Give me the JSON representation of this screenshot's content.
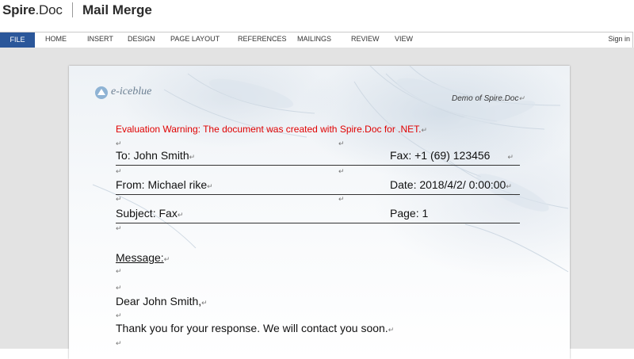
{
  "header": {
    "brand_main": "Spire",
    "brand_sub": ".Doc",
    "title": "Mail Merge"
  },
  "ribbon": {
    "file": "FILE",
    "tabs": [
      "HOME",
      "INSERT",
      "DESIGN",
      "PAGE LAYOUT",
      "REFERENCES",
      "MAILINGS",
      "REVIEW",
      "VIEW"
    ],
    "sign_in": "Sign in"
  },
  "document": {
    "logo_text": "e-iceblue",
    "demo_label": "Demo of Spire.Doc",
    "warning": "Evaluation Warning: The document was created with Spire.Doc for .NET.",
    "para_mark": "↵",
    "fields": {
      "to": "To:   John Smith",
      "fax": "Fax:  +1 (69) 123456",
      "from": "From:       Michael rike",
      "date": "Date:  2018/4/2/ 0:00:00",
      "subject": "Subject: Fax",
      "page": "Page: 1"
    },
    "message_label": "Message:",
    "greeting": "Dear John Smith,",
    "body": "Thank you for your response. We will contact you soon."
  },
  "colors": {
    "ribbon_file": "#2b579a",
    "warning": "#e00000"
  }
}
